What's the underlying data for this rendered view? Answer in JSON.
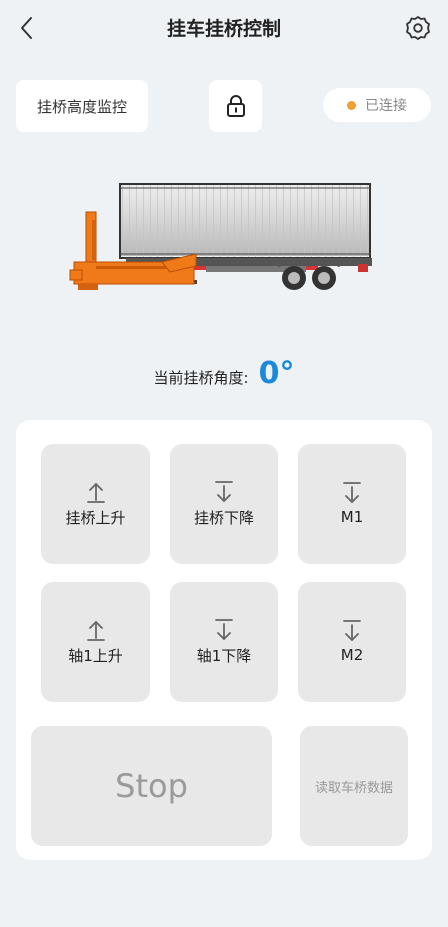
{
  "header": {
    "title": "挂车挂桥控制",
    "back_icon": "chevron-left-icon",
    "settings_icon": "gear-icon"
  },
  "toolbar": {
    "monitor_label": "挂桥高度监控",
    "lock_icon": "lock-icon",
    "status_label": "已连接",
    "status_color": "#f0a030"
  },
  "angle": {
    "label": "当前挂桥角度:",
    "value": "0°",
    "value_color": "#1a8ad9"
  },
  "controls": {
    "row1": [
      {
        "label": "挂桥上升",
        "icon": "arrow-up-icon"
      },
      {
        "label": "挂桥下降",
        "icon": "arrow-down-icon"
      },
      {
        "label": "M1",
        "icon": "arrow-down-icon"
      }
    ],
    "row2": [
      {
        "label": "轴1上升",
        "icon": "arrow-up-icon"
      },
      {
        "label": "轴1下降",
        "icon": "arrow-down-icon"
      },
      {
        "label": "M2",
        "icon": "arrow-down-icon"
      }
    ],
    "stop_label": "Stop",
    "read_label": "读取车桥数据"
  }
}
